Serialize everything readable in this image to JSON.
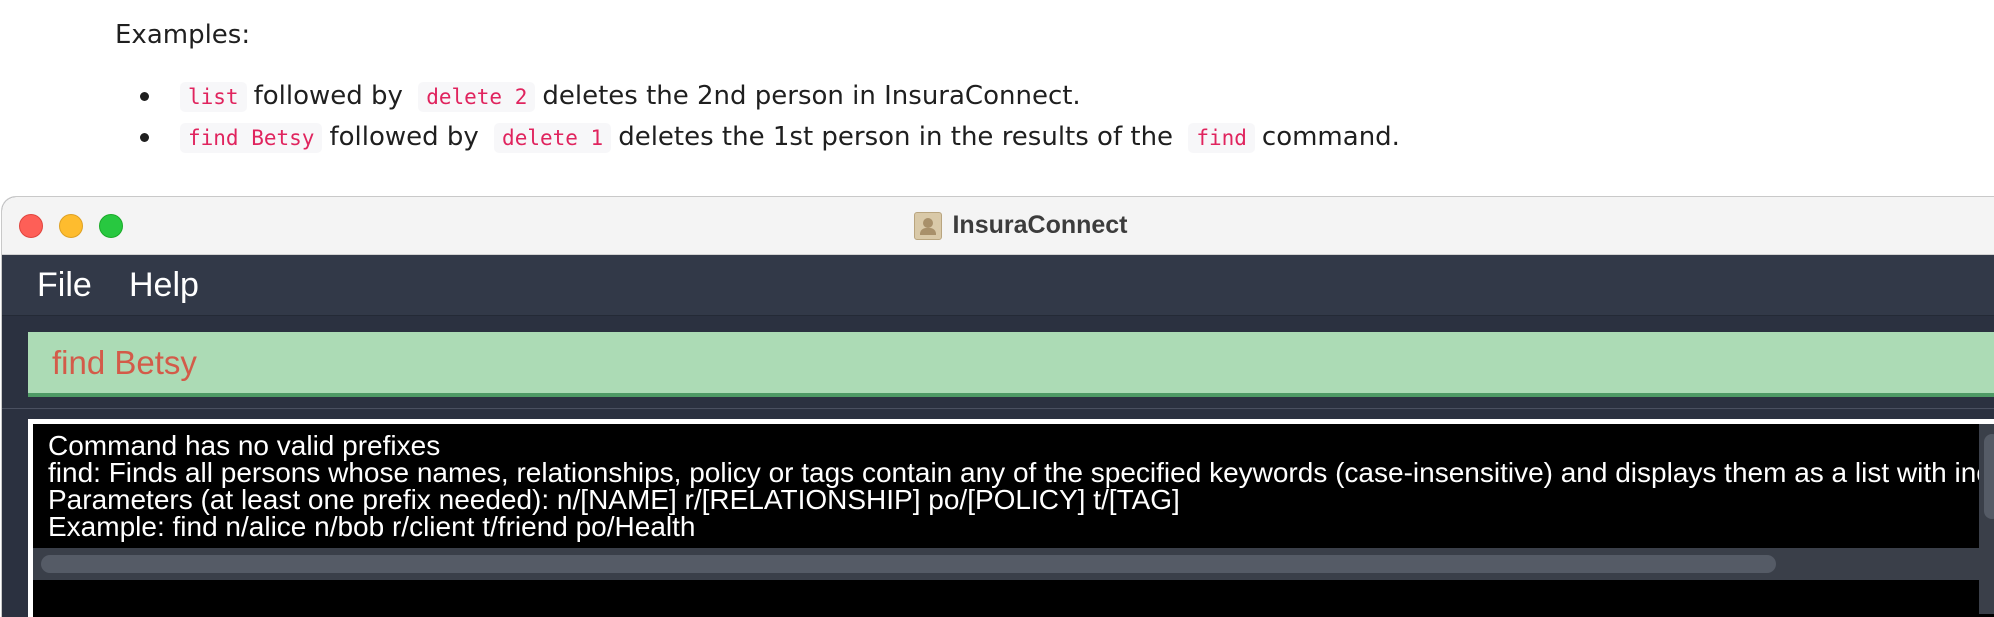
{
  "doc": {
    "heading": "Examples:",
    "examples": [
      {
        "parts": [
          {
            "type": "code",
            "text": "list"
          },
          {
            "type": "text",
            "text": "followed by"
          },
          {
            "type": "code",
            "text": "delete 2"
          },
          {
            "type": "text",
            "text": "deletes the 2nd person in InsuraConnect."
          }
        ]
      },
      {
        "parts": [
          {
            "type": "code",
            "text": "find Betsy"
          },
          {
            "type": "text",
            "text": "followed by"
          },
          {
            "type": "code",
            "text": "delete 1"
          },
          {
            "type": "text",
            "text": "deletes the 1st person in the results of the"
          },
          {
            "type": "code",
            "text": "find"
          },
          {
            "type": "text",
            "text": "command."
          }
        ]
      }
    ]
  },
  "window": {
    "title": "InsuraConnect",
    "icon": "address-book-icon",
    "traffic_lights": {
      "close": "#fe5f57",
      "minimize": "#febc2e",
      "maximize": "#28c840"
    }
  },
  "menu": {
    "file": "File",
    "help": "Help"
  },
  "command_box": {
    "value": "find Betsy",
    "background": "#acdbb5",
    "text_color": "#d35b49"
  },
  "result": {
    "lines": [
      "Command has no valid prefixes",
      "find: Finds all persons whose names, relationships, policy or tags contain any of the specified keywords (case-insensitive) and displays them as a list with inc",
      "Parameters (at least one prefix needed): n/[NAME] r/[RELATIONSHIP] po/[POLICY] t/[TAG]",
      "Example: find n/alice n/bob r/client t/friend po/Health"
    ]
  }
}
